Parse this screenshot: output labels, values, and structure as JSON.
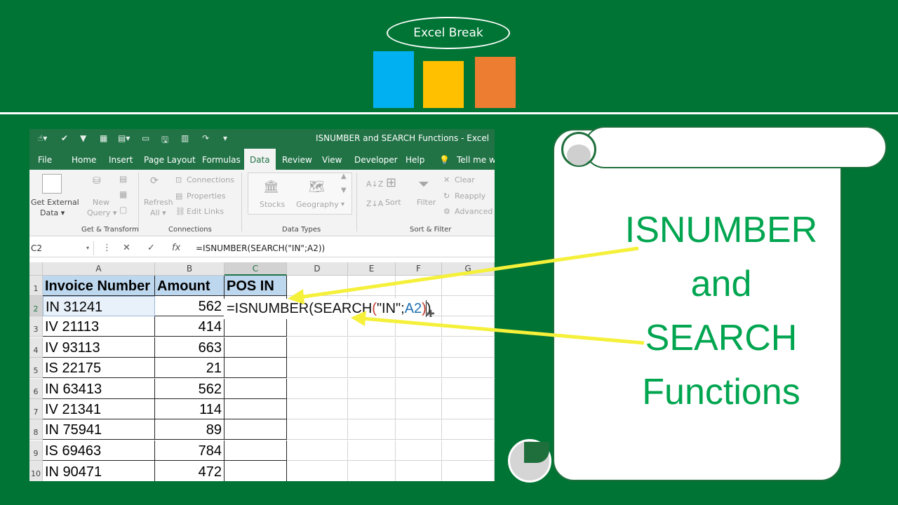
{
  "brand": {
    "name": "Excel Break"
  },
  "window": {
    "title": "ISNUMBER and SEARCH Functions - Excel",
    "tabs": [
      "File",
      "Home",
      "Insert",
      "Page Layout",
      "Formulas",
      "Data",
      "Review",
      "View",
      "Developer",
      "Help",
      "Tell me wh"
    ],
    "active_tab": "Data"
  },
  "ribbon": {
    "get_external": {
      "line1": "Get External",
      "line2": "Data ▾"
    },
    "new_query": {
      "line1": "New",
      "line2": "Query ▾"
    },
    "refresh": {
      "line1": "Refresh",
      "line2": "All ▾"
    },
    "connections": [
      "Connections",
      "Properties",
      "Edit Links"
    ],
    "stocks": "Stocks",
    "geography": "Geography",
    "sort": "Sort",
    "filter": "Filter",
    "filter_items": [
      "Clear",
      "Reapply",
      "Advanced"
    ],
    "groups": [
      "Get & Transform",
      "Connections",
      "Data Types",
      "Sort & Filter"
    ]
  },
  "formula_bar": {
    "name_box": "C2",
    "cancel": "✕",
    "enter": "✓",
    "fx": "fx",
    "formula": "=ISNUMBER(SEARCH(\"IN\";A2))"
  },
  "sheet": {
    "columns": [
      "A",
      "B",
      "C",
      "D",
      "E",
      "F",
      "G"
    ],
    "rows": [
      "1",
      "2",
      "3",
      "4",
      "5",
      "6",
      "7",
      "8",
      "9",
      "10"
    ],
    "headers": [
      "Invoice Number",
      "Amount",
      "POS IN"
    ],
    "data": [
      {
        "invoice": "IN 31241",
        "amount": "562"
      },
      {
        "invoice": "IV 21113",
        "amount": "414"
      },
      {
        "invoice": "IV 93113",
        "amount": "663"
      },
      {
        "invoice": "IS 22175",
        "amount": "21"
      },
      {
        "invoice": "IN 63413",
        "amount": "562"
      },
      {
        "invoice": "IV 21341",
        "amount": "114"
      },
      {
        "invoice": "IN 75941",
        "amount": "89"
      },
      {
        "invoice": "IS 69463",
        "amount": "784"
      },
      {
        "invoice": "IN 90471",
        "amount": "472"
      }
    ],
    "edit_cell": {
      "p1": "=ISNUMBER(SEARCH",
      "paren_open": "(",
      "p2": "\"IN\";",
      "ref": "A2",
      "paren_close": ")",
      "p3": ")"
    }
  },
  "scroll": {
    "lines": [
      "ISNUMBER",
      "and",
      "SEARCH",
      "Functions"
    ]
  },
  "colors": {
    "background": "#007434",
    "excel_green": "#217346",
    "header_fill": "#bdd7ee",
    "arrow": "#f5f03a",
    "title_green": "#00a550"
  }
}
